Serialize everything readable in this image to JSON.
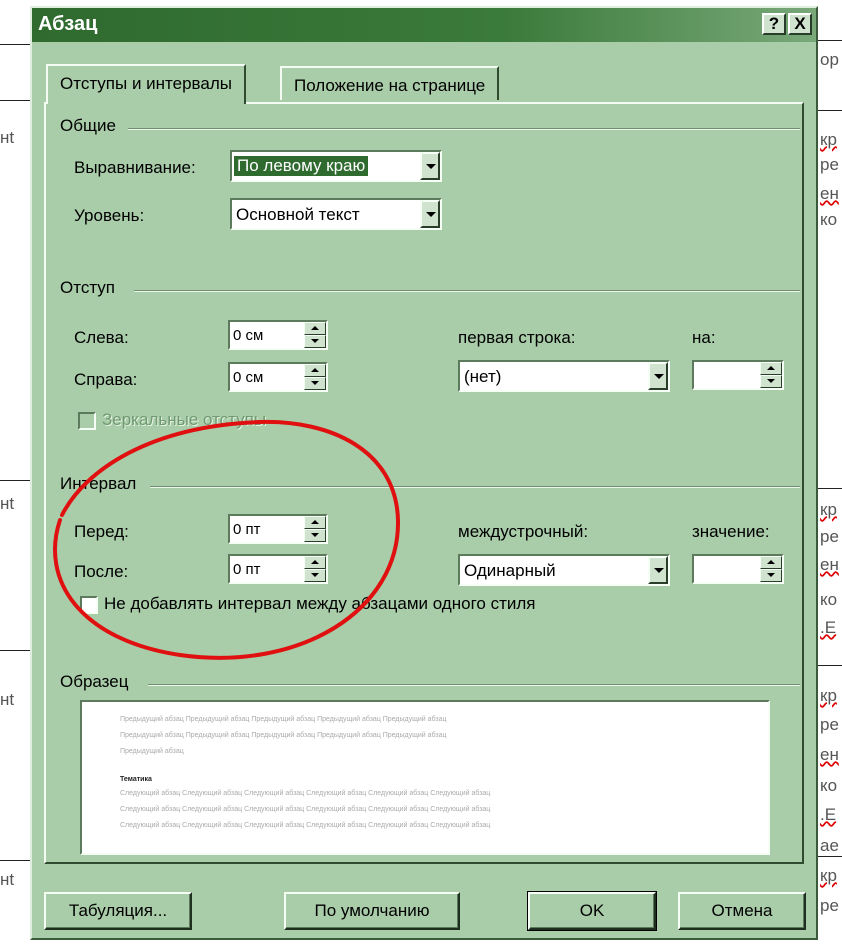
{
  "dialog": {
    "title": "Абзац",
    "help_label": "?",
    "close_label": "X"
  },
  "tabs": [
    {
      "label": "Отступы и интервалы",
      "active": true
    },
    {
      "label": "Положение на странице",
      "active": false
    }
  ],
  "general": {
    "heading": "Общие",
    "alignment_label": "Выравнивание:",
    "alignment_value": "По левому краю",
    "level_label": "Уровень:",
    "level_value": "Основной текст"
  },
  "indent": {
    "heading": "Отступ",
    "left_label": "Слева:",
    "left_value": "0 см",
    "right_label": "Справа:",
    "right_value": "0 см",
    "first_line_label": "первая строка:",
    "first_line_value": "(нет)",
    "by_label": "на:",
    "by_value": "",
    "mirror_label": "Зеркальные отступы"
  },
  "spacing": {
    "heading": "Интервал",
    "before_label": "Перед:",
    "before_value": "0 пт",
    "after_label": "После:",
    "after_value": "0 пт",
    "line_label": "междустрочный:",
    "line_value": "Одинарный",
    "value_label": "значение:",
    "value_value": "",
    "no_space_label": "Не добавлять интервал между абзацами одного стиля"
  },
  "preview": {
    "heading": "Образец",
    "prev_lines": [
      "Предыдущий абзац Предыдущий абзац Предыдущий абзац Предыдущий абзац Предыдущий абзац",
      "Предыдущий абзац Предыдущий абзац Предыдущий абзац Предыдущий абзац Предыдущий абзац",
      "Предыдущий абзац"
    ],
    "sample": "Тематика",
    "next_lines": [
      "Следующий абзац Следующий абзац Следующий абзац Следующий абзац Следующий абзац Следующий абзац",
      "Следующий абзац Следующий абзац Следующий абзац Следующий абзац Следующий абзац Следующий абзац",
      "Следующий абзац Следующий абзац Следующий абзац Следующий абзац Следующий абзац Следующий абзац"
    ]
  },
  "buttons": {
    "tabs": "Табуляция...",
    "default": "По умолчанию",
    "ok": "OK",
    "cancel": "Отмена"
  },
  "background": {
    "left_fragments": [
      "нt",
      "нt",
      "нt",
      "нt"
    ],
    "right_fragments": [
      "ор",
      "кр",
      "ре",
      "ен",
      "ко",
      "кр",
      "ре",
      "ен",
      "ко",
      ".Е",
      "кр",
      "ре",
      "ен",
      "ко",
      ".Е",
      "ае",
      "кр",
      "ре"
    ]
  },
  "colors": {
    "dialog_bg": "#a9cca9",
    "titlebar": "#2f6a2f",
    "annotation": "#e01010"
  }
}
